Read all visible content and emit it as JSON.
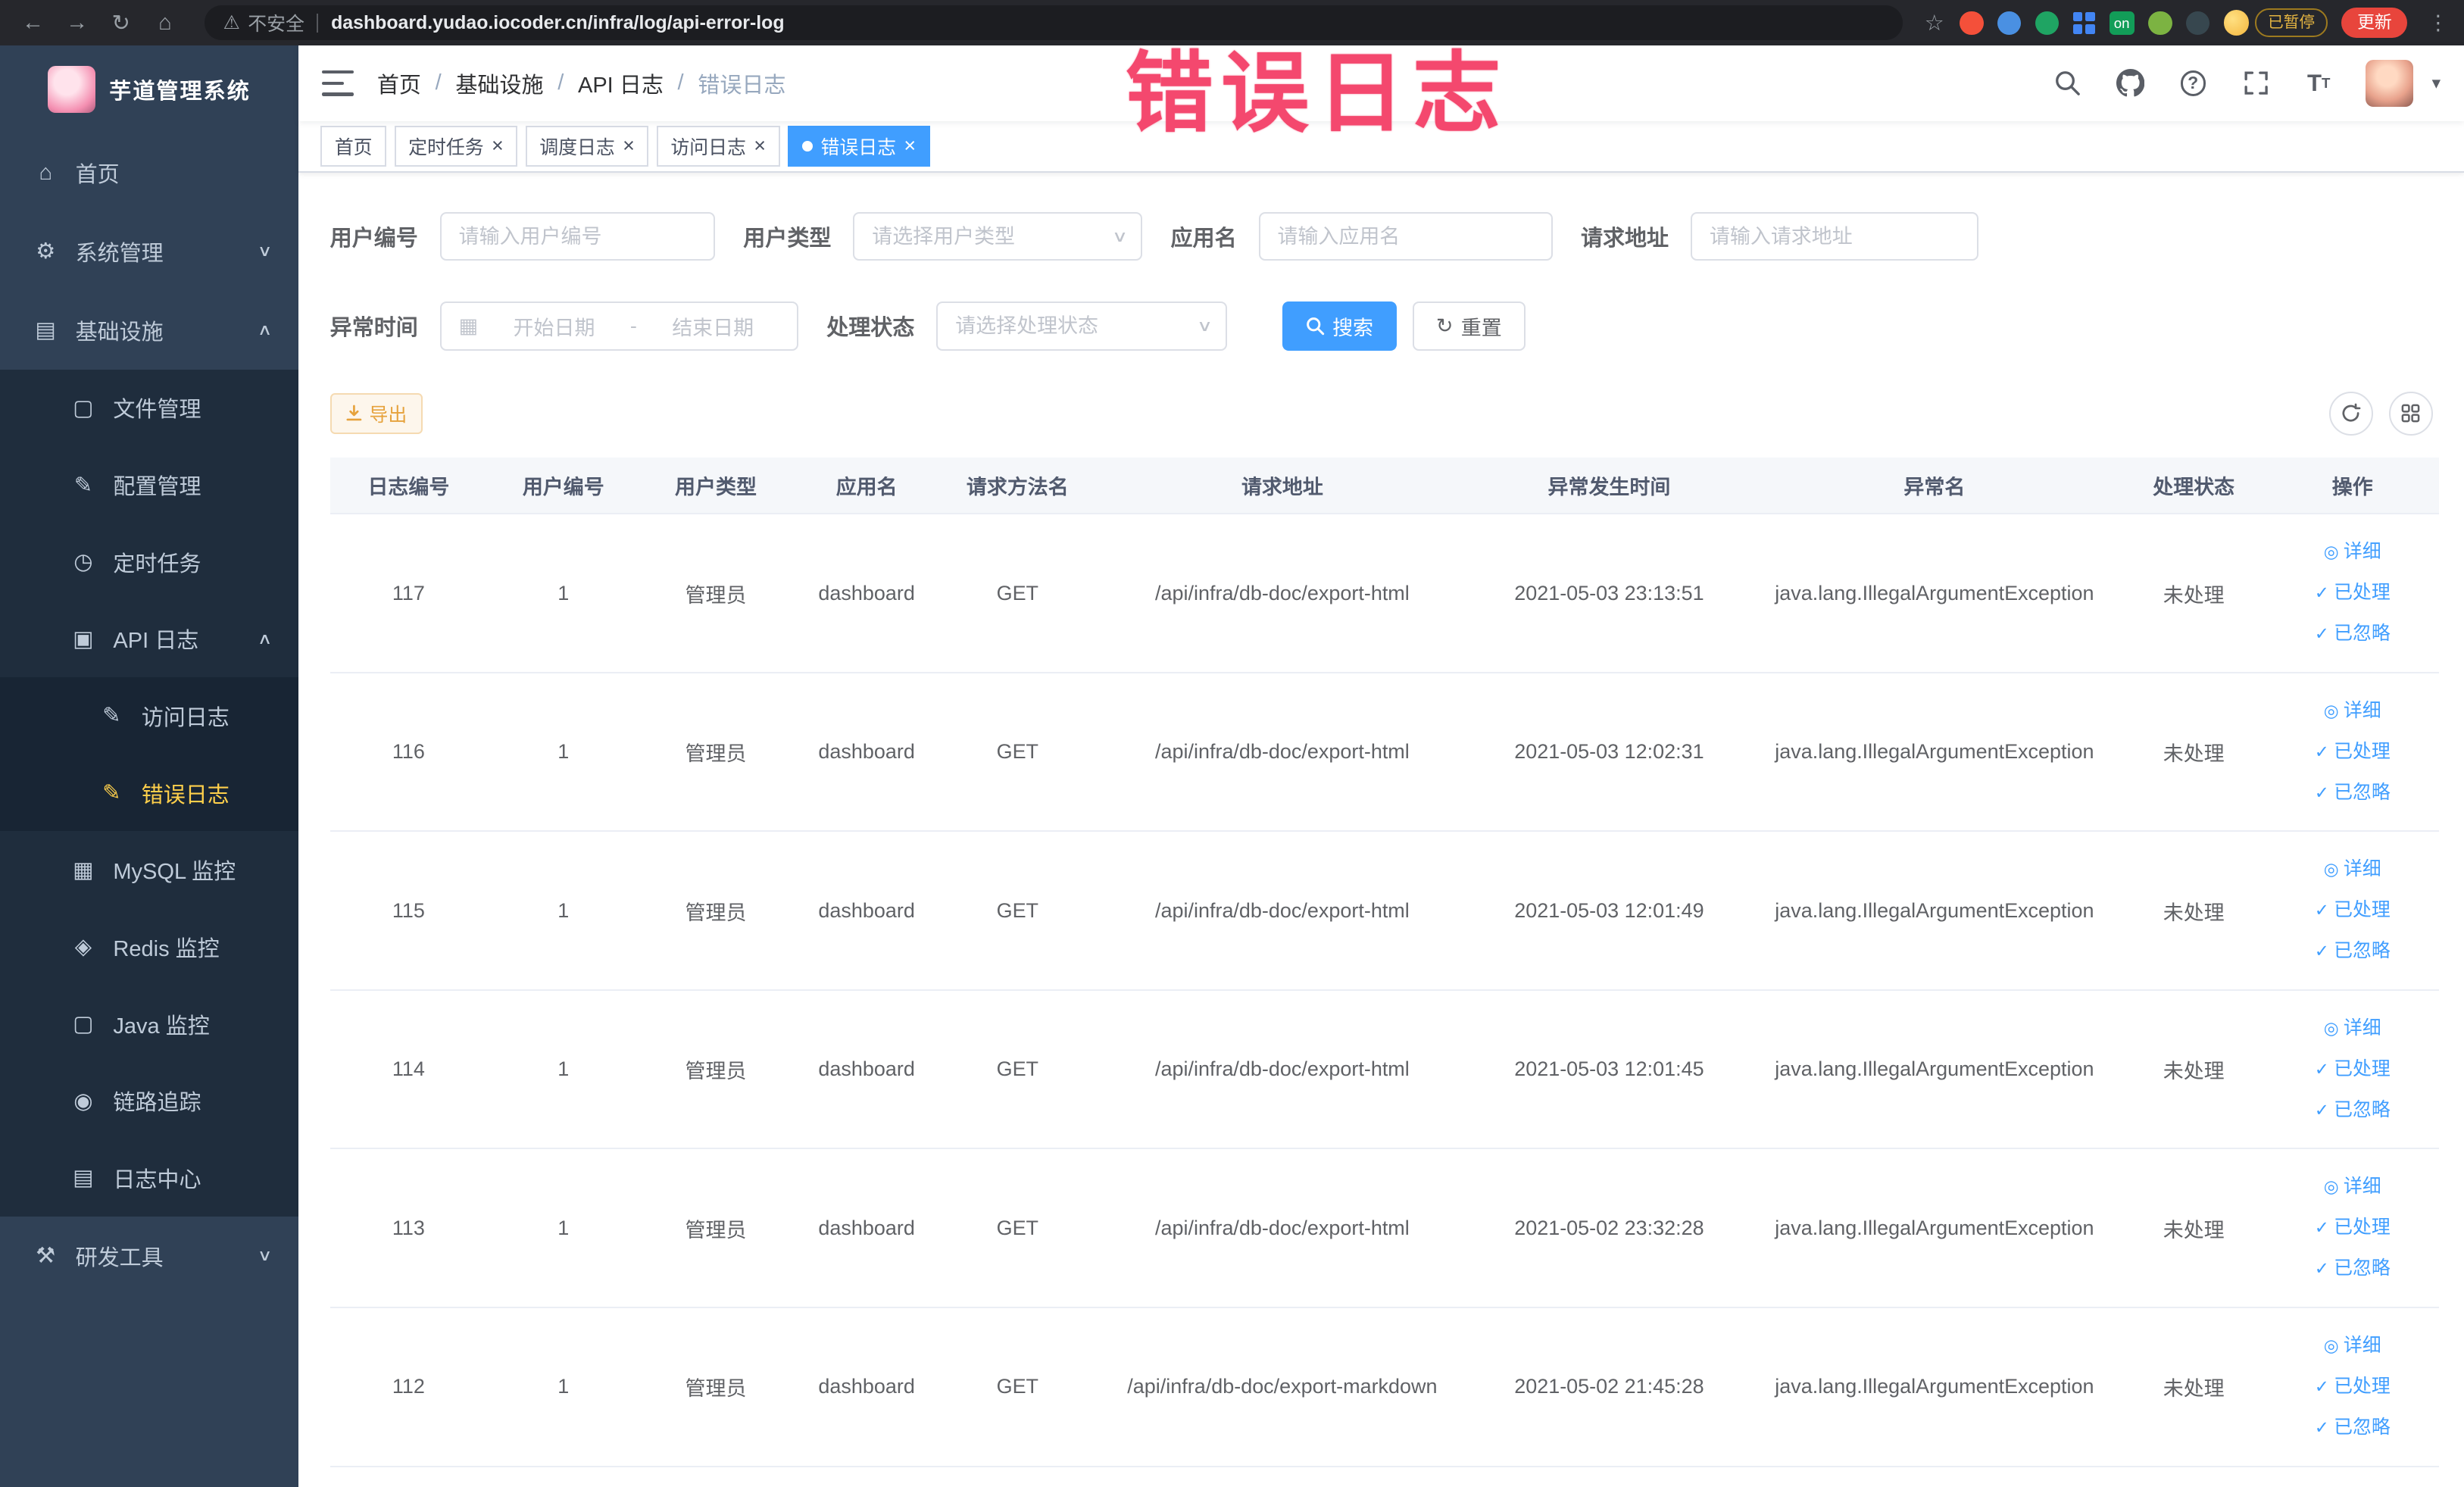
{
  "colors": {
    "accent": "#409eff",
    "sidebar": "#304156",
    "menu_active": "#ffd04b",
    "warning": "#e6a23c",
    "annotation": "#f4486e"
  },
  "annotation": {
    "text": "错误日志"
  },
  "browser": {
    "security_label": "不安全",
    "url": "dashboard.yudao.iocoder.cn/infra/log/api-error-log",
    "extension_on_badge": "on",
    "paused_badge": "已暂停",
    "update_button": "更新"
  },
  "sidebar": {
    "logo_title": "芋道管理系统",
    "items": [
      {
        "id": "home",
        "label": "首页",
        "icon": "home-icon",
        "glyph": "home",
        "level": 1
      },
      {
        "id": "system",
        "label": "系统管理",
        "icon": "gear-icon",
        "glyph": "gear",
        "level": 1,
        "chevron": "down"
      },
      {
        "id": "infra",
        "label": "基础设施",
        "icon": "monitor-icon",
        "glyph": "infra",
        "level": 1,
        "chevron": "up"
      },
      {
        "id": "file",
        "label": "文件管理",
        "icon": "folder-icon",
        "glyph": "file",
        "level": 2
      },
      {
        "id": "config",
        "label": "配置管理",
        "icon": "edit-icon",
        "glyph": "config",
        "level": 2
      },
      {
        "id": "job",
        "label": "定时任务",
        "icon": "clock-icon",
        "glyph": "clock",
        "level": 2
      },
      {
        "id": "api-log",
        "label": "API 日志",
        "icon": "document-icon",
        "glyph": "apilog",
        "level": 2,
        "chevron": "up"
      },
      {
        "id": "access-log",
        "label": "访问日志",
        "icon": "edit-document-icon",
        "glyph": "accesslog",
        "level": 3
      },
      {
        "id": "error-log",
        "label": "错误日志",
        "icon": "edit-document-icon",
        "glyph": "errorlog",
        "level": 3,
        "active": true
      },
      {
        "id": "mysql",
        "label": "MySQL 监控",
        "icon": "grid-icon",
        "glyph": "mysql",
        "level": 2
      },
      {
        "id": "redis",
        "label": "Redis 监控",
        "icon": "layers-icon",
        "glyph": "redis",
        "level": 2
      },
      {
        "id": "java",
        "label": "Java 监控",
        "icon": "monitor-icon",
        "glyph": "java",
        "level": 2
      },
      {
        "id": "trace",
        "label": "链路追踪",
        "icon": "eye-icon",
        "glyph": "trace",
        "level": 2
      },
      {
        "id": "log-center",
        "label": "日志中心",
        "icon": "document-icon",
        "glyph": "logcenter",
        "level": 2
      },
      {
        "id": "dev-tools",
        "label": "研发工具",
        "icon": "tools-icon",
        "glyph": "tools",
        "level": 1,
        "chevron": "down"
      }
    ]
  },
  "header": {
    "breadcrumb": [
      "首页",
      "基础设施",
      "API 日志",
      "错误日志"
    ]
  },
  "tabs": [
    {
      "label": "首页",
      "closable": false,
      "active": false
    },
    {
      "label": "定时任务",
      "closable": true,
      "active": false
    },
    {
      "label": "调度日志",
      "closable": true,
      "active": false
    },
    {
      "label": "访问日志",
      "closable": true,
      "active": false
    },
    {
      "label": "错误日志",
      "closable": true,
      "active": true
    }
  ],
  "filters": {
    "user_id": {
      "label": "用户编号",
      "placeholder": "请输入用户编号"
    },
    "user_type": {
      "label": "用户类型",
      "placeholder": "请选择用户类型"
    },
    "app_name": {
      "label": "应用名",
      "placeholder": "请输入应用名"
    },
    "request_url": {
      "label": "请求地址",
      "placeholder": "请输入请求地址"
    },
    "exception_time": {
      "label": "异常时间",
      "start_placeholder": "开始日期",
      "separator": "-",
      "end_placeholder": "结束日期"
    },
    "process_status": {
      "label": "处理状态",
      "placeholder": "请选择处理状态"
    },
    "search_button": "搜索",
    "reset_button": "重置"
  },
  "toolbar": {
    "export_button": "导出"
  },
  "table": {
    "headers": [
      "日志编号",
      "用户编号",
      "用户类型",
      "应用名",
      "请求方法名",
      "请求地址",
      "异常发生时间",
      "异常名",
      "处理状态",
      "操作"
    ],
    "actions": [
      "详细",
      "已处理",
      "已忽略"
    ],
    "rows": [
      {
        "id": "117",
        "user_id": "1",
        "user_type": "管理员",
        "app": "dashboard",
        "method": "GET",
        "url": "/api/infra/db-doc/export-html",
        "time": "2021-05-03 23:13:51",
        "exception": "java.lang.IllegalArgumentException",
        "status": "未处理"
      },
      {
        "id": "116",
        "user_id": "1",
        "user_type": "管理员",
        "app": "dashboard",
        "method": "GET",
        "url": "/api/infra/db-doc/export-html",
        "time": "2021-05-03 12:02:31",
        "exception": "java.lang.IllegalArgumentException",
        "status": "未处理"
      },
      {
        "id": "115",
        "user_id": "1",
        "user_type": "管理员",
        "app": "dashboard",
        "method": "GET",
        "url": "/api/infra/db-doc/export-html",
        "time": "2021-05-03 12:01:49",
        "exception": "java.lang.IllegalArgumentException",
        "status": "未处理"
      },
      {
        "id": "114",
        "user_id": "1",
        "user_type": "管理员",
        "app": "dashboard",
        "method": "GET",
        "url": "/api/infra/db-doc/export-html",
        "time": "2021-05-03 12:01:45",
        "exception": "java.lang.IllegalArgumentException",
        "status": "未处理"
      },
      {
        "id": "113",
        "user_id": "1",
        "user_type": "管理员",
        "app": "dashboard",
        "method": "GET",
        "url": "/api/infra/db-doc/export-html",
        "time": "2021-05-02 23:32:28",
        "exception": "java.lang.IllegalArgumentException",
        "status": "未处理"
      },
      {
        "id": "112",
        "user_id": "1",
        "user_type": "管理员",
        "app": "dashboard",
        "method": "GET",
        "url": "/api/infra/db-doc/export-markdown",
        "time": "2021-05-02 21:45:28",
        "exception": "java.lang.IllegalArgumentException",
        "status": "未处理"
      }
    ]
  }
}
